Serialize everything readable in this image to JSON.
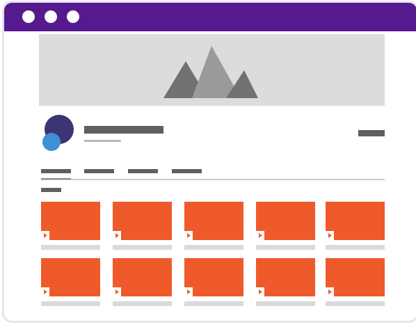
{
  "window": {
    "titlebar_color": "#561a8f",
    "controls": [
      "window-dot",
      "window-dot",
      "window-dot"
    ]
  },
  "banner": {
    "icon": "mountain-image-icon",
    "background": "#dcdcdc"
  },
  "channel": {
    "avatar_colors": [
      "#3b3573",
      "#3f8fd2"
    ],
    "name_placeholder": "",
    "subtitle_placeholder": "",
    "action_placeholder": ""
  },
  "tabs": [
    {
      "selected": true
    },
    {
      "selected": false
    },
    {
      "selected": false
    },
    {
      "selected": false
    }
  ],
  "section": {
    "heading_placeholder": ""
  },
  "videos": {
    "thumbnail_color": "#ef5a2b",
    "rows": [
      [
        {
          "icon": "play-icon"
        },
        {
          "icon": "play-icon"
        },
        {
          "icon": "play-icon"
        },
        {
          "icon": "play-icon"
        },
        {
          "icon": "play-icon"
        }
      ],
      [
        {
          "icon": "play-icon"
        },
        {
          "icon": "play-icon"
        },
        {
          "icon": "play-icon"
        },
        {
          "icon": "play-icon"
        },
        {
          "icon": "play-icon"
        }
      ]
    ]
  }
}
